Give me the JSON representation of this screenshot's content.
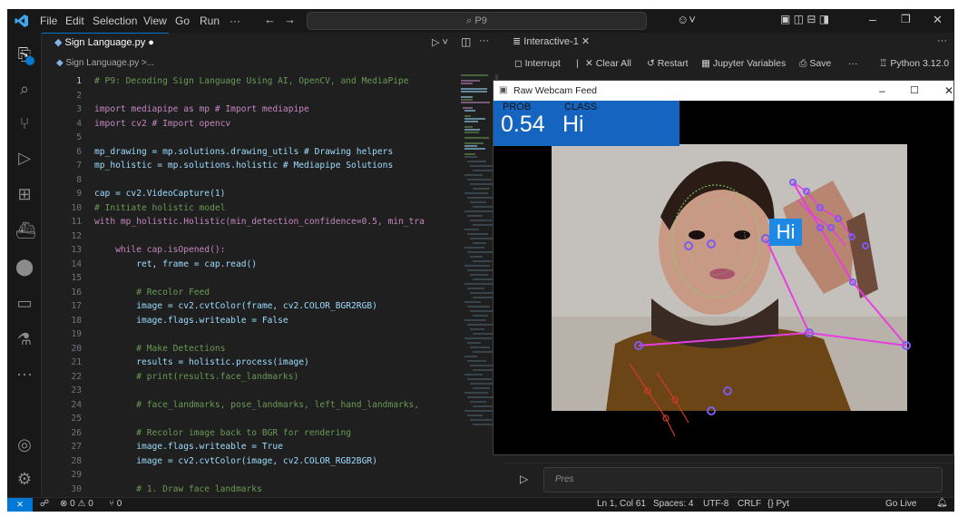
{
  "titlebar": {
    "menu": [
      "File",
      "Edit",
      "Selection",
      "View",
      "Go",
      "Run",
      "···"
    ],
    "search": "P9",
    "nav_back": "←",
    "nav_forward": "→"
  },
  "editor": {
    "tab_label": "Sign Language.py",
    "breadcrumb": "Sign Language.py >...",
    "lines": [
      {
        "n": "1",
        "t": "# P9: Decoding Sign Language Using AI, OpenCV, and MediaPipe",
        "k": "cmt"
      },
      {
        "n": "2",
        "t": "",
        "k": ""
      },
      {
        "n": "3",
        "t": "import mediapipe as mp # Import mediapipe",
        "k": "imp"
      },
      {
        "n": "4",
        "t": "import cv2 # Import opencv",
        "k": "imp"
      },
      {
        "n": "5",
        "t": "",
        "k": ""
      },
      {
        "n": "6",
        "t": "mp_drawing = mp.solutions.drawing_utils # Drawing helpers",
        "k": "asg"
      },
      {
        "n": "7",
        "t": "mp_holistic = mp.solutions.holistic # Mediapipe Solutions",
        "k": "asg"
      },
      {
        "n": "8",
        "t": "",
        "k": ""
      },
      {
        "n": "9",
        "t": "cap = cv2.VideoCapture(1)",
        "k": "asg"
      },
      {
        "n": "10",
        "t": "# Initiate holistic model",
        "k": "cmt"
      },
      {
        "n": "11",
        "t": "with mp_holistic.Holistic(min_detection_confidence=0.5, min_tra",
        "k": "with"
      },
      {
        "n": "12",
        "t": "",
        "k": ""
      },
      {
        "n": "13",
        "t": "    while cap.isOpened():",
        "k": "kw"
      },
      {
        "n": "14",
        "t": "        ret, frame = cap.read()",
        "k": "asg"
      },
      {
        "n": "15",
        "t": "",
        "k": ""
      },
      {
        "n": "16",
        "t": "        # Recolor Feed",
        "k": "cmt"
      },
      {
        "n": "17",
        "t": "        image = cv2.cvtColor(frame, cv2.COLOR_BGR2RGB)",
        "k": "asg"
      },
      {
        "n": "18",
        "t": "        image.flags.writeable = False",
        "k": "asg"
      },
      {
        "n": "19",
        "t": "",
        "k": ""
      },
      {
        "n": "20",
        "t": "        # Make Detections",
        "k": "cmt"
      },
      {
        "n": "21",
        "t": "        results = holistic.process(image)",
        "k": "asg"
      },
      {
        "n": "22",
        "t": "        # print(results.face_landmarks)",
        "k": "cmt"
      },
      {
        "n": "23",
        "t": "",
        "k": ""
      },
      {
        "n": "24",
        "t": "        # face_landmarks, pose_landmarks, left_hand_landmarks,",
        "k": "cmt"
      },
      {
        "n": "25",
        "t": "",
        "k": ""
      },
      {
        "n": "26",
        "t": "        # Recolor image back to BGR for rendering",
        "k": "cmt"
      },
      {
        "n": "27",
        "t": "        image.flags.writeable = True",
        "k": "asg"
      },
      {
        "n": "28",
        "t": "        image = cv2.cvtColor(image, cv2.COLOR_RGB2BGR)",
        "k": "asg"
      },
      {
        "n": "29",
        "t": "",
        "k": ""
      },
      {
        "n": "30",
        "t": "        # 1. Draw face landmarks",
        "k": "cmt"
      }
    ]
  },
  "interactive": {
    "tab_label": "Interactive-1",
    "toolbar": {
      "interrupt": "Interrupt",
      "clear_all": "Clear All",
      "restart": "Restart",
      "variables": "Jupyter Variables",
      "save": "Save",
      "more": "···",
      "kernel": "Python 3.12.0"
    },
    "input_placeholder": "Pres"
  },
  "webcam": {
    "title": "Raw Webcam Feed",
    "prob_label": "PROB",
    "class_label": "CLASS",
    "prob_value": "0.54",
    "class_value": "Hi",
    "overlay_label": "Hi"
  },
  "statusbar": {
    "problems": "⊗ 0 ⚠ 0",
    "ports": "⑂ 0",
    "position": "Ln 1, Col 61",
    "spaces": "Spaces: 4",
    "encoding": "UTF-8",
    "eol": "CRLF",
    "language": "{} Pyt",
    "live": "Go Live"
  },
  "colors": {
    "accent": "#0078d4",
    "webcam_label_bg": "#1565c0",
    "pose_line": "#e83ee0",
    "landmark": "#7a5cf0"
  }
}
